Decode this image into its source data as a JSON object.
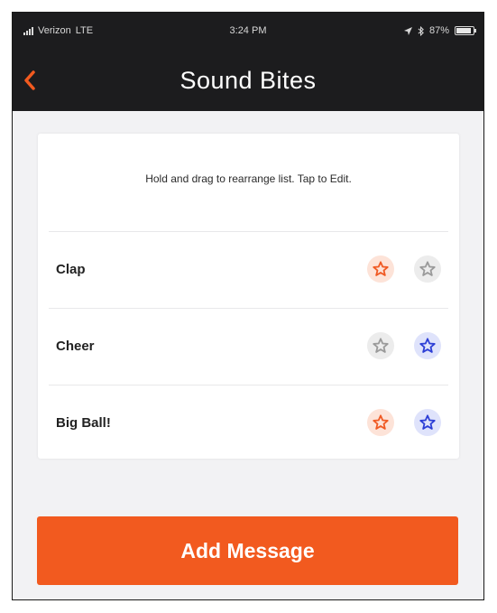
{
  "status_bar": {
    "carrier": "Verizon",
    "network": "LTE",
    "time": "3:24 PM",
    "battery": "87%",
    "battery_level": 0.87
  },
  "header": {
    "title": "Sound Bites",
    "back_icon": "chevron-left-icon"
  },
  "instructions": "Hold and drag to rearrange list. Tap to Edit.",
  "sound_bites": [
    {
      "label": "Clap",
      "star_1": "orange",
      "star_2": "gray"
    },
    {
      "label": "Cheer",
      "star_1": "gray",
      "star_2": "blue"
    },
    {
      "label": "Big Ball!",
      "star_1": "orange",
      "star_2": "blue"
    }
  ],
  "add_button_label": "Add Message",
  "colors": {
    "accent": "#f25a1f",
    "header_bg": "#1c1c1e",
    "star_orange": "#f05a24",
    "star_blue": "#2d3fd6",
    "star_gray": "#9a9a9a"
  }
}
